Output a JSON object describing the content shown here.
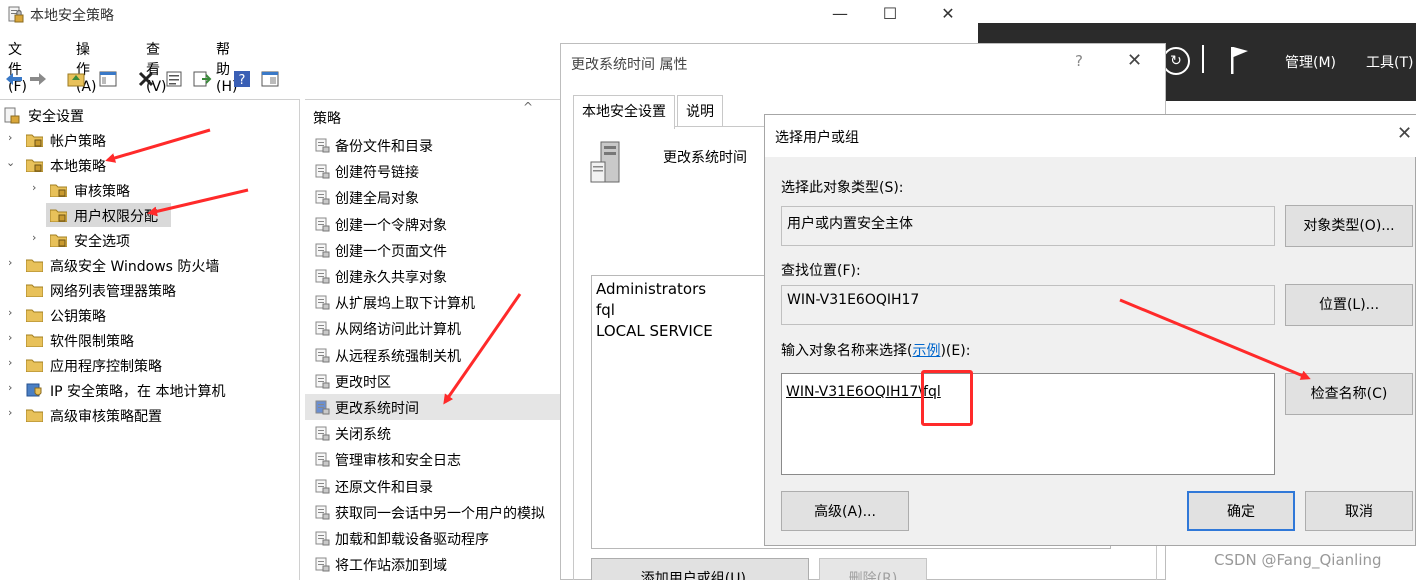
{
  "main": {
    "title": "本地安全策略",
    "window_buttons": {
      "minimize": "—",
      "maximize": "☐",
      "close": "✕"
    },
    "menu": [
      "文件(F)",
      "操作(A)",
      "查看(V)",
      "帮助(H)"
    ],
    "tree": [
      {
        "label": "安全设置",
        "level": 0,
        "expand": ""
      },
      {
        "label": "帐户策略",
        "level": 1,
        "expand": "›"
      },
      {
        "label": "本地策略",
        "level": 1,
        "expand": "⌄"
      },
      {
        "label": "审核策略",
        "level": 2,
        "expand": "›"
      },
      {
        "label": "用户权限分配",
        "level": 2,
        "expand": "",
        "selected": true
      },
      {
        "label": "安全选项",
        "level": 2,
        "expand": "›"
      },
      {
        "label": "高级安全 Windows 防火墙",
        "level": 1,
        "expand": "›"
      },
      {
        "label": "网络列表管理器策略",
        "level": 1,
        "expand": ""
      },
      {
        "label": "公钥策略",
        "level": 1,
        "expand": "›"
      },
      {
        "label": "软件限制策略",
        "level": 1,
        "expand": "›"
      },
      {
        "label": "应用程序控制策略",
        "level": 1,
        "expand": "›"
      },
      {
        "label": "IP 安全策略，在 本地计算机",
        "level": 1,
        "expand": "›"
      },
      {
        "label": "高级审核策略配置",
        "level": 1,
        "expand": "›"
      }
    ],
    "policy_header": "策略",
    "policy_sort": "^",
    "policies": [
      "备份文件和目录",
      "创建符号链接",
      "创建全局对象",
      "创建一个令牌对象",
      "创建一个页面文件",
      "创建永久共享对象",
      "从扩展坞上取下计算机",
      "从网络访问此计算机",
      "从远程系统强制关机",
      "更改时区",
      "更改系统时间",
      "关闭系统",
      "管理审核和安全日志",
      "还原文件和目录",
      "获取同一会话中另一个用户的模拟",
      "加载和卸载设备驱动程序",
      "将工作站添加到域"
    ],
    "highlighted_policy_index": 10
  },
  "server_bar": {
    "separator": "|",
    "refresh_glyph": "↻",
    "menus": [
      "管理(M)",
      "工具(T)"
    ]
  },
  "properties": {
    "title": "更改系统时间 属性",
    "help": "?",
    "close": "✕",
    "tabs": [
      "本地安全设置",
      "说明"
    ],
    "policy_name": "更改系统时间",
    "members": [
      "Administrators",
      "fql",
      "LOCAL SERVICE"
    ],
    "add_button": "添加用户或组(U)...",
    "remove_button": "删除(R)"
  },
  "select_dialog": {
    "title": "选择用户或组",
    "close": "✕",
    "object_type_label": "选择此对象类型(S):",
    "object_type_value": "用户或内置安全主体",
    "object_types_button": "对象类型(O)...",
    "location_label": "查找位置(F):",
    "location_value": "WIN-V31E6OQIH17",
    "location_button": "位置(L)...",
    "names_label_prefix": "输入对象名称来选择(",
    "names_label_link": "示例",
    "names_label_suffix": ")(E):",
    "names_value": "WIN-V31E6OQIH17\\fql",
    "check_names_button": "检查名称(C)",
    "advanced_button": "高级(A)...",
    "ok_button": "确定",
    "cancel_button": "取消"
  },
  "watermark": "CSDN @Fang_Qianling",
  "colors": {
    "annotation_red": "#ff2a2a",
    "folder_yellow": "#e8c15a",
    "dark_bar": "#2b2b2b",
    "link_blue": "#0066cc"
  }
}
